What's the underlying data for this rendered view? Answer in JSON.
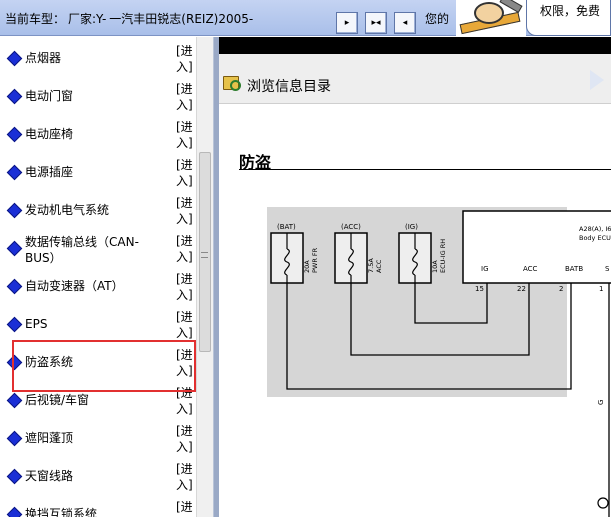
{
  "header": {
    "car_prefix": "当前车型：",
    "maker_label": "厂家:Y-",
    "model": "一汽丰田锐志(REIZ)2005-",
    "welcome_text": "您的",
    "bubble_text": "权限，免费"
  },
  "nav_buttons": [
    {
      "name": "next-page-button",
      "glyph": "▸"
    },
    {
      "name": "expand-button",
      "glyph": "▸◂"
    },
    {
      "name": "prev-page-button",
      "glyph": "◂"
    }
  ],
  "sidebar": {
    "enter_label": "[进入]",
    "items": [
      {
        "label": "点烟器"
      },
      {
        "label": "电动门窗"
      },
      {
        "label": "电动座椅"
      },
      {
        "label": "电源插座"
      },
      {
        "label": "发动机电气系统"
      },
      {
        "label": "数据传输总线（CAN-BUS）"
      },
      {
        "label": "自动变速器（AT）"
      },
      {
        "label": "EPS"
      },
      {
        "label": "防盗系统"
      },
      {
        "label": "后视镜/车窗"
      },
      {
        "label": "遮阳蓬顶"
      },
      {
        "label": "天窗线路"
      },
      {
        "label": "换挡互锁系统"
      }
    ],
    "selected_index": 8
  },
  "content": {
    "toolbar_title": "浏览信息目录",
    "page_heading": "防盗",
    "diagram": {
      "fuses": [
        {
          "top_label": "(BAT)",
          "rating": "20A",
          "name": "PWR FR"
        },
        {
          "top_label": "(ACC)",
          "rating": "7.5A",
          "name": "ACC"
        },
        {
          "top_label": "(IG)",
          "rating": "10A",
          "name": "ECU-IG RH"
        }
      ],
      "ecu": {
        "label1": "A28(A), I6",
        "label2": "Body ECU",
        "pins": [
          {
            "name": "IG",
            "number": "15"
          },
          {
            "name": "ACC",
            "number": "22"
          },
          {
            "name": "BATB",
            "number": "2"
          },
          {
            "name": "S",
            "number": "1"
          }
        ]
      },
      "wire_label": "G"
    }
  },
  "colors": {
    "header_bg": "#b6c8ee",
    "diamond": "#1a2fd6",
    "highlight": "#e23030",
    "diagram_panel": "#d6d6d6"
  }
}
